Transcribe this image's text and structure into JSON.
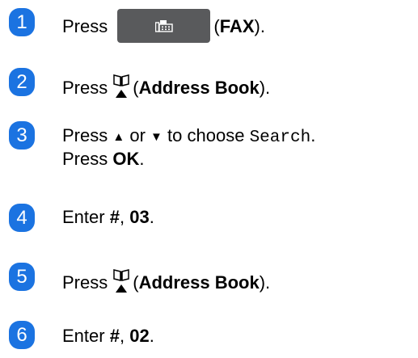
{
  "steps": [
    {
      "num": "1",
      "press": "Press",
      "open": "(",
      "label": "FAX",
      "close": ")."
    },
    {
      "num": "2",
      "press": "Press",
      "open": "(",
      "label": "Address Book",
      "close": ")."
    },
    {
      "num": "3",
      "press": "Press",
      "up": "▲",
      "or": "or",
      "down": "▼",
      "to_choose": "to choose",
      "option": "Search",
      "period": ".",
      "press2": "Press",
      "ok": "OK",
      "period2": "."
    },
    {
      "num": "4",
      "enter": "Enter",
      "v1": "#",
      "sep": ",",
      "v2": "03",
      "period": "."
    },
    {
      "num": "5",
      "press": "Press",
      "open": "(",
      "label": "Address Book",
      "close": ")."
    },
    {
      "num": "6",
      "enter": "Enter",
      "v1": "#",
      "sep": ",",
      "v2": "02",
      "period": "."
    }
  ],
  "colors": {
    "badge": "#1b73e1",
    "fax_button": "#595a5c"
  },
  "icons": {
    "fax": "fax-icon",
    "address_book": "address-book-icon"
  }
}
